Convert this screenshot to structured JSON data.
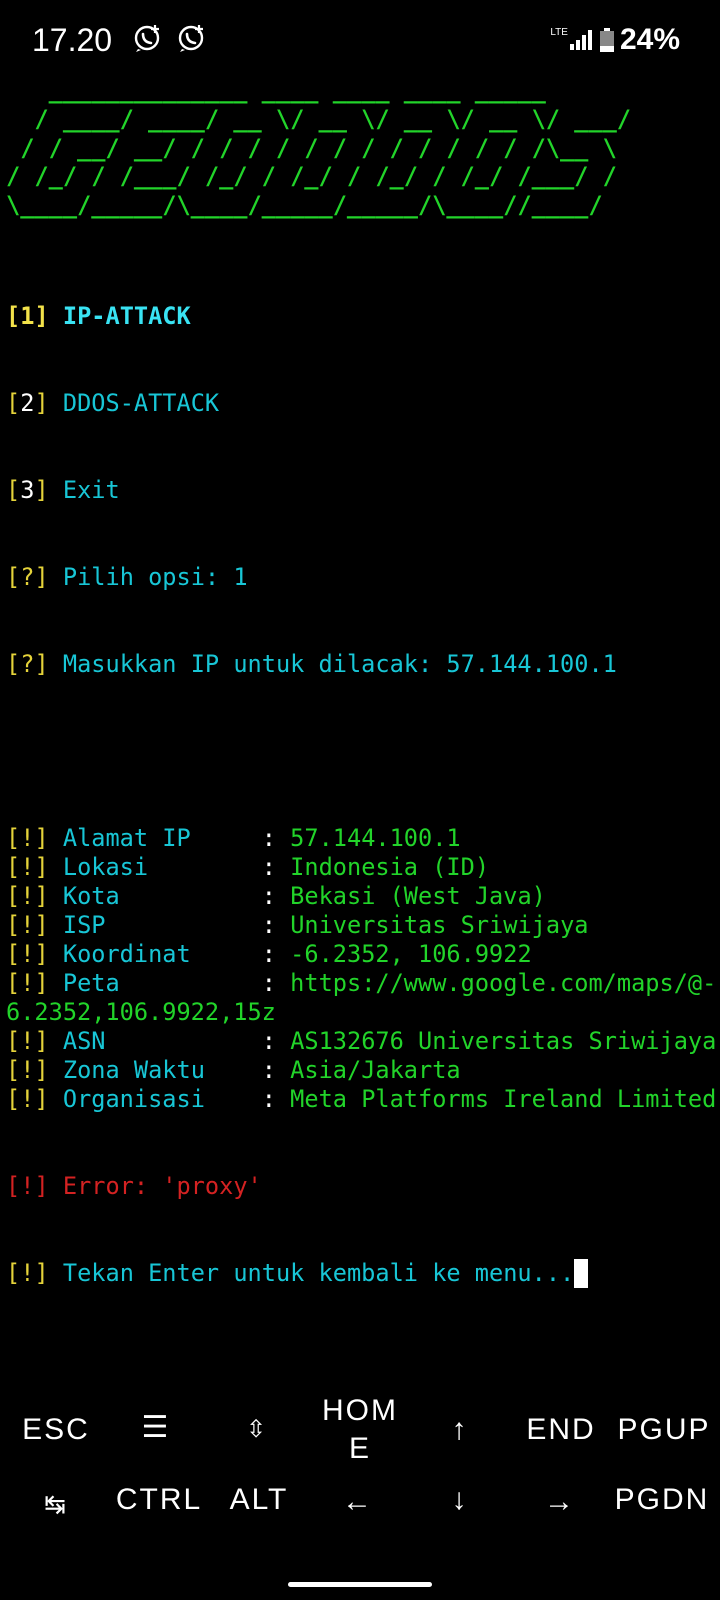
{
  "status_bar": {
    "time": "17.20",
    "network": "LTE",
    "battery": "24%",
    "icons": [
      "whatsapp-icon",
      "whatsapp-icon",
      "signal-icon",
      "battery-icon"
    ]
  },
  "banner": "   ______________ ____ ____ ____ _____\n  / ____/ ____/ __ \\/ __ \\/ __ \\/ __ \\/ ___/\n / / __/ __/ / / / / / / / / / / / / /\\__ \\\n/ /_/ / /___/ /_/ / /_/ / /_/ / /_/ /___/ /\n\\____/_____/\\____/_____/_____/\\____//____/",
  "terminal": {
    "menu": [
      {
        "num": "1",
        "label": "IP-ATTACK"
      },
      {
        "num": "2",
        "label": "DDOS-ATTACK"
      },
      {
        "num": "3",
        "label": "Exit"
      }
    ],
    "prompt_choice": {
      "tag": "?",
      "label": "Pilih opsi: 1"
    },
    "prompt_ip": {
      "tag": "?",
      "label": "Masukkan IP untuk dilacak: 57.144.100.1"
    },
    "info": [
      {
        "key": "Alamat IP",
        "value": "57.144.100.1"
      },
      {
        "key": "Lokasi",
        "value": "Indonesia (ID)"
      },
      {
        "key": "Kota",
        "value": "Bekasi (West Java)"
      },
      {
        "key": "ISP",
        "value": "Universitas Sriwijaya"
      },
      {
        "key": "Koordinat",
        "value": "-6.2352, 106.9922"
      },
      {
        "key": "Peta",
        "value": "https://www.google.com/maps/@-",
        "value_wrap": "6.2352,106.9922,15z"
      },
      {
        "key": "ASN",
        "value": "AS132676 Universitas Sriwijaya"
      },
      {
        "key": "Zona Waktu",
        "value": "Asia/Jakarta"
      },
      {
        "key": "Organisasi",
        "value": "Meta Platforms Ireland Limited"
      }
    ],
    "info_tag": "!",
    "separator": ":",
    "error": "Error: 'proxy'",
    "enter_prompt": "Tekan Enter untuk kembali ke menu..."
  },
  "keys": {
    "esc": "ESC",
    "menu": "☰",
    "updown": "⇳",
    "home_1": "HOM",
    "home_2": "E",
    "up": "↑",
    "end": "END",
    "pgup": "PGUP",
    "tab": "↹",
    "ctrl": "CTRL",
    "alt": "ALT",
    "left": "←",
    "down": "↓",
    "right": "→",
    "pgdn": "PGDN"
  },
  "colors": {
    "background": "#000000",
    "green": "#22d42a",
    "cyan": "#18c6d6",
    "yellow": "#e5d33a",
    "red": "#d42222"
  }
}
